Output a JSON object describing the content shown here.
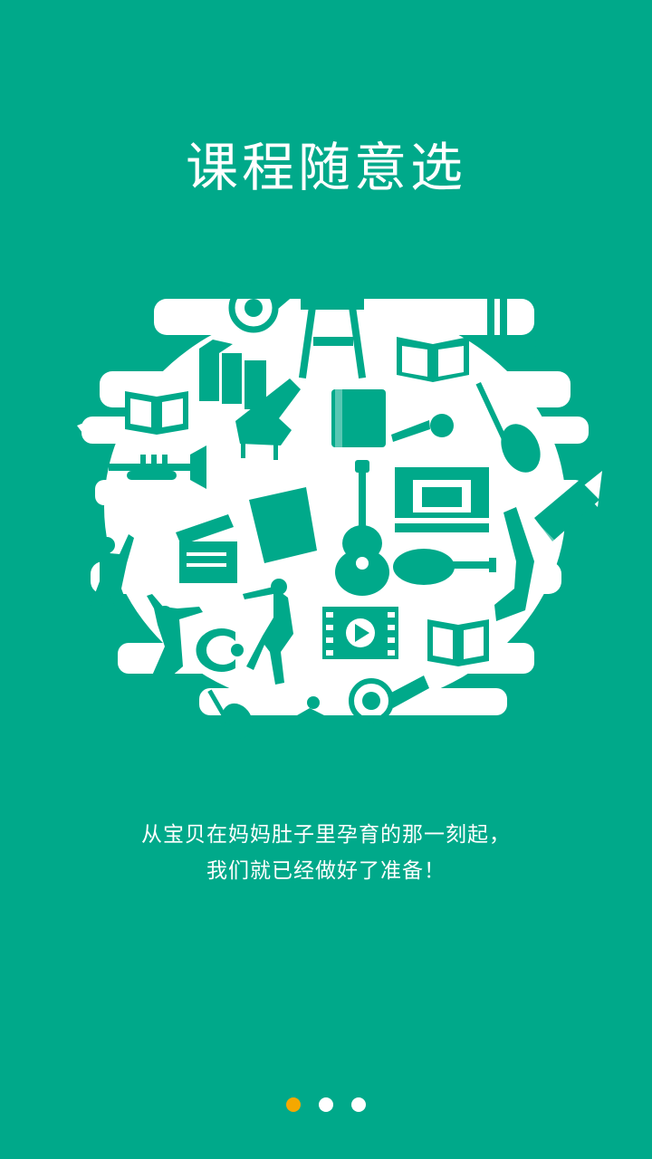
{
  "screen": {
    "title": "课程随意选",
    "description_line1": "从宝贝在妈妈肚子里孕育的那一刻起，",
    "description_line2": "我们就已经做好了准备！",
    "background_color": "#00a98a"
  },
  "illustration": {
    "icons": [
      "french-horn-icon",
      "easel-icon",
      "books-icon",
      "open-book-icon",
      "grand-piano-icon",
      "closed-book-icon",
      "microphone-icon",
      "violin-icon",
      "trumpet-icon",
      "theater-stage-icon",
      "accordion-icon",
      "clapperboard-icon",
      "guitar-icon",
      "lute-icon",
      "saxophone-icon",
      "dancer-icon",
      "skater-icon",
      "film-strip-icon",
      "cello-icon",
      "gymnast-icon"
    ]
  },
  "pager": {
    "pages": 3,
    "active_index": 0,
    "active_color": "#f5a800",
    "inactive_color": "#ffffff"
  }
}
